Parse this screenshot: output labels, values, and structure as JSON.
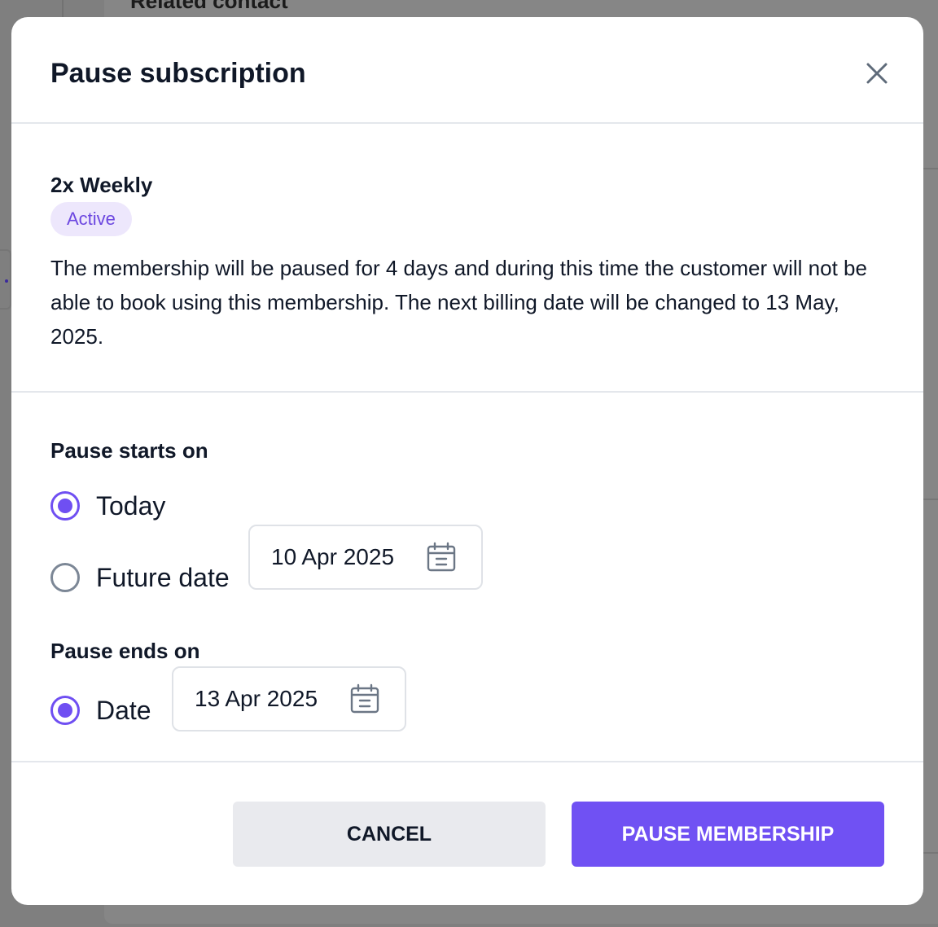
{
  "background": {
    "heading": "Related contact"
  },
  "modal": {
    "title": "Pause subscription",
    "close_icon": "close-icon"
  },
  "plan": {
    "name": "2x Weekly",
    "status": "Active",
    "description": "The membership will be paused for 4 days and during this time the customer will not be able to book using this membership. The next billing date will be changed to 13 May, 2025."
  },
  "pause_start": {
    "label": "Pause starts on",
    "options": [
      {
        "label": "Today",
        "checked": true
      },
      {
        "label": "Future date",
        "checked": false
      }
    ],
    "future_date_value": "10 Apr 2025",
    "calendar_icon": "calendar-icon"
  },
  "pause_end": {
    "label": "Pause ends on",
    "option_label": "Date",
    "checked": true,
    "date_value": "13 Apr 2025",
    "calendar_icon": "calendar-icon"
  },
  "footer": {
    "cancel_label": "CANCEL",
    "confirm_label": "PAUSE MEMBERSHIP"
  },
  "colors": {
    "accent": "#7051f3",
    "badge_bg": "#ede7fc",
    "badge_text": "#6c47e0",
    "overlay": "#7f7f7f"
  }
}
